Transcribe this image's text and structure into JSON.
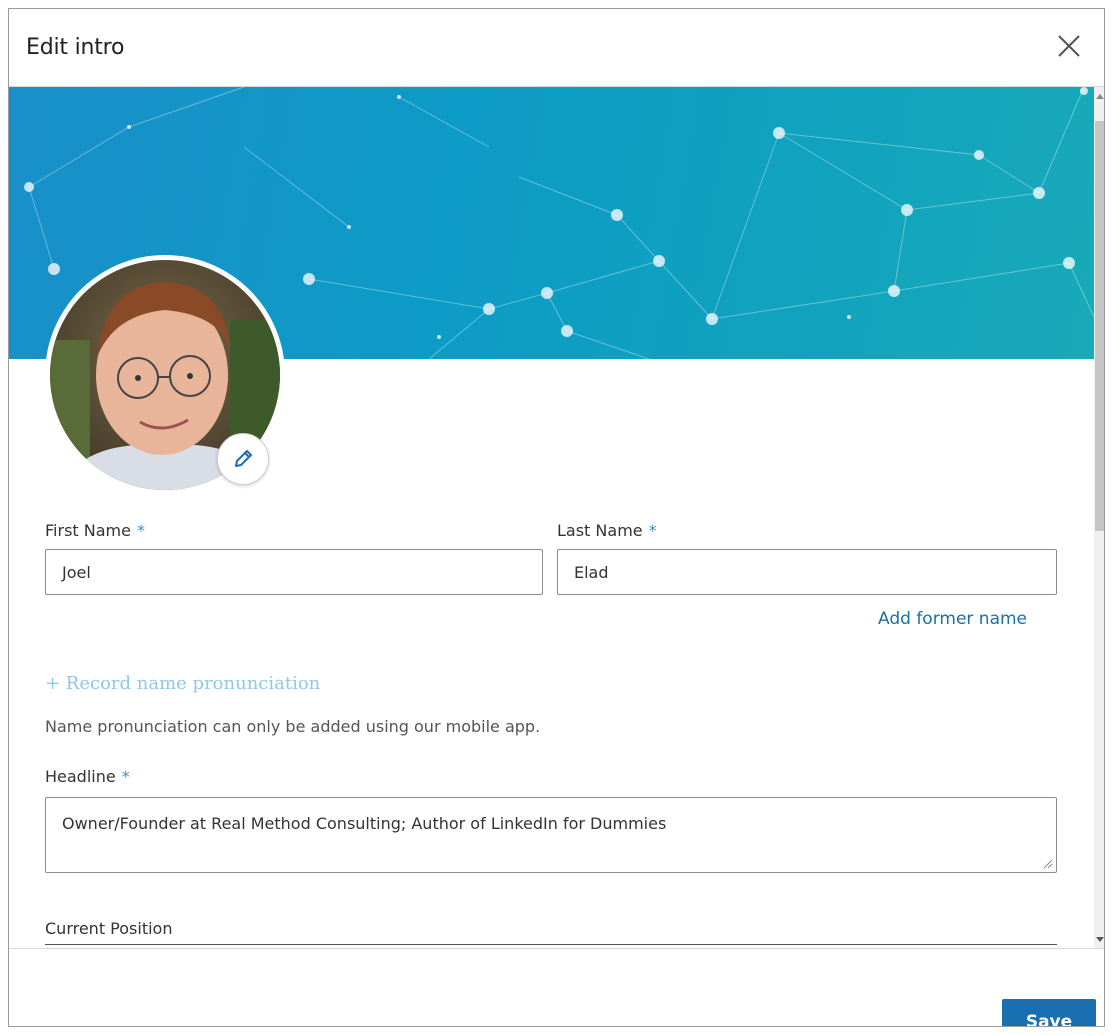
{
  "dialog": {
    "title": "Edit intro",
    "close_icon": "close-icon"
  },
  "colors": {
    "accent": "#1a6fb0",
    "banner": "#10a2bf",
    "required_asterisk": "#3d91c2",
    "record_link": "#8ec9e8"
  },
  "form": {
    "first_name_label": "First Name",
    "first_name_value": "Joel",
    "last_name_label": "Last Name",
    "last_name_value": "Elad",
    "required_mark": "*",
    "add_former_name": "Add former name",
    "record_pronunciation": "+ Record name pronunciation",
    "pronunciation_helper": "Name pronunciation can only be added using our mobile app.",
    "headline_label": "Headline",
    "headline_value": "Owner/Founder at Real Method Consulting; Author of LinkedIn for Dummies",
    "current_position_label": "Current Position"
  },
  "footer": {
    "save_label": "Save"
  }
}
